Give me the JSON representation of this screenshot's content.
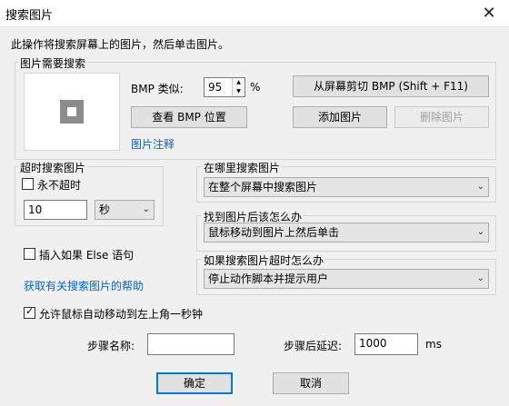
{
  "window": {
    "title": "搜索图片",
    "close_glyph": "✕"
  },
  "instruction": "此操作将搜索屏幕上的图片，然后单击图片。",
  "image_group": {
    "title": "图片需要搜索",
    "bmp_similarity_label": "BMP 类似:",
    "bmp_similarity_value": "95",
    "percent": "%",
    "capture_button": "从屏幕剪切 BMP (Shift + F11)",
    "view_bmp_button": "查看 BMP 位置",
    "add_image_button": "添加图片",
    "delete_image_button": "删除图片",
    "image_note_link": "图片注释"
  },
  "timeout_group": {
    "title": "超时搜索图片",
    "never_timeout_label": "永不超时",
    "never_timeout_checked": false,
    "timeout_value": "10",
    "unit_selected": "秒"
  },
  "where_group": {
    "title": "在哪里搜索图片",
    "selected": "在整个屏幕中搜索图片"
  },
  "found_group": {
    "title": "找到图片后该怎么办",
    "selected": "鼠标移动到图片上然后单击"
  },
  "timeout_action_group": {
    "title": "如果搜索图片超时怎么办",
    "selected": "停止动作脚本并提示用户"
  },
  "insert_else_label": "插入如果 Else 语句",
  "insert_else_checked": false,
  "help_link": "获取有关搜索图片的帮助",
  "allow_mouse_label": "允许鼠标自动移动到左上角一秒钟",
  "allow_mouse_checked": true,
  "step_name_label": "步骤名称:",
  "step_name_value": "",
  "delay_label": "步骤后延迟:",
  "delay_value": "1000",
  "delay_unit": "ms",
  "ok_button": "确定",
  "cancel_button": "取消",
  "icons": {
    "spinner_up": "▲",
    "spinner_down": "▼",
    "dropdown": "⌄"
  }
}
